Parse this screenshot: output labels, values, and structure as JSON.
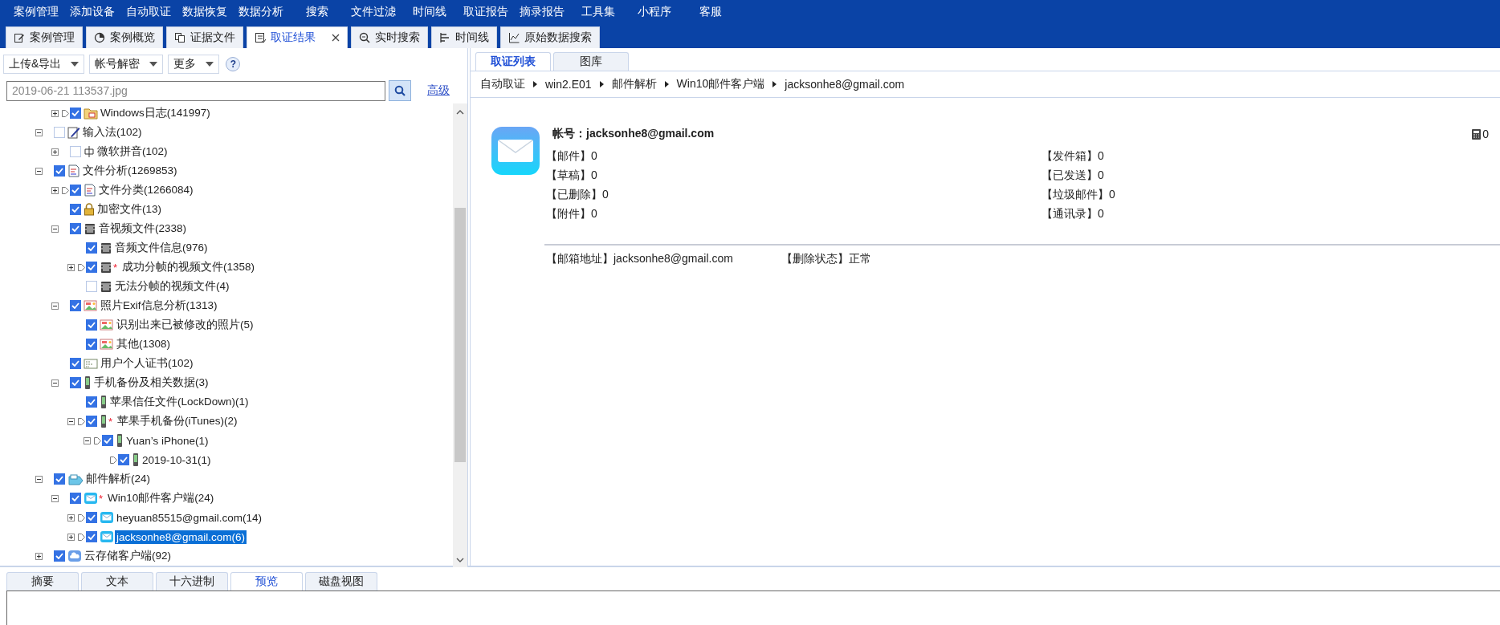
{
  "menu": [
    {
      "label": "案例管理"
    },
    {
      "label": "添加设备"
    },
    {
      "label": "自动取证"
    },
    {
      "label": "数据恢复"
    },
    {
      "label": "数据分析"
    },
    {
      "label": "搜索"
    },
    {
      "label": "文件过滤"
    },
    {
      "label": "时间线"
    },
    {
      "label": "取证报告"
    },
    {
      "label": "摘录报告"
    },
    {
      "label": "工具集"
    },
    {
      "label": "小程序"
    },
    {
      "label": "客服"
    }
  ],
  "doc_tabs": [
    {
      "label": "案例管理",
      "kind": "edit",
      "selected": false
    },
    {
      "label": "案例概览",
      "kind": "pie",
      "selected": false
    },
    {
      "label": "证据文件",
      "kind": "copy",
      "selected": false
    },
    {
      "label": "取证结果",
      "kind": "list",
      "selected": true,
      "closable": true
    },
    {
      "label": "实时搜索",
      "kind": "search",
      "selected": false
    },
    {
      "label": "时间线",
      "kind": "timeline",
      "selected": false
    },
    {
      "label": "原始数据搜索",
      "kind": "chart",
      "selected": false
    }
  ],
  "left_toolbar": {
    "dropdowns": [
      "上传&导出",
      "帐号解密",
      "更多"
    ],
    "help": "?"
  },
  "search": {
    "placeholder": "2019-06-21 113537.jpg",
    "advanced_link": "高级"
  },
  "tree": {
    "continued_children": [
      {
        "label": "Windows日志(141997)",
        "kind": "log",
        "checked": true,
        "expanded": false,
        "marker": true,
        "selected": false
      }
    ],
    "items": [
      {
        "label": "输入法(102)",
        "kind": "pen",
        "checked": false,
        "expanded": true,
        "selected": false,
        "children": [
          {
            "label": "微软拼音(102)",
            "kind": "ime",
            "checked": false,
            "expanded": false,
            "selected": false
          }
        ]
      },
      {
        "label": "文件分析(1269853)",
        "kind": "doc",
        "checked": true,
        "expanded": true,
        "selected": false,
        "children": [
          {
            "label": "文件分类(1266084)",
            "kind": "doc",
            "checked": true,
            "expanded": false,
            "marker": true,
            "selected": false
          },
          {
            "label": "加密文件(13)",
            "kind": "lock",
            "checked": true,
            "selected": false
          },
          {
            "label": "音视频文件(2338)",
            "kind": "media",
            "checked": true,
            "expanded": true,
            "selected": false,
            "children": [
              {
                "label": "音频文件信息(976)",
                "kind": "media",
                "checked": true,
                "selected": false
              },
              {
                "label": "成功分帧的视频文件(1358)",
                "kind": "media",
                "checked": true,
                "expanded": false,
                "marker": true,
                "mark": "*",
                "selected": false
              },
              {
                "label": "无法分帧的视频文件(4)",
                "kind": "media",
                "checked": false,
                "selected": false
              }
            ]
          },
          {
            "label": "照片Exif信息分析(1313)",
            "kind": "photo",
            "checked": true,
            "expanded": true,
            "selected": false,
            "children": [
              {
                "label": "识别出来已被修改的照片(5)",
                "kind": "photo",
                "checked": true,
                "selected": false
              },
              {
                "label": "其他(1308)",
                "kind": "photo",
                "checked": true,
                "selected": false
              }
            ]
          },
          {
            "label": "用户个人证书(102)",
            "kind": "cert",
            "checked": true,
            "selected": false
          },
          {
            "label": "手机备份及相关数据(3)",
            "kind": "phone",
            "checked": true,
            "expanded": true,
            "selected": false,
            "children": [
              {
                "label": "苹果信任文件(LockDown)(1)",
                "kind": "phone",
                "checked": true,
                "selected": false
              },
              {
                "label": "苹果手机备份(iTunes)(2)",
                "kind": "phone",
                "checked": true,
                "expanded": true,
                "marker": true,
                "mark": "*",
                "selected": false,
                "children": [
                  {
                    "label": "Yuan’s iPhone(1)",
                    "kind": "phone",
                    "checked": true,
                    "expanded": true,
                    "marker": true,
                    "selected": false,
                    "children": [
                      {
                        "label": "2019-10-31(1)",
                        "kind": "phone",
                        "checked": true,
                        "marker": true,
                        "selected": false
                      }
                    ]
                  }
                ]
              }
            ]
          }
        ]
      },
      {
        "label": "邮件解析(24)",
        "kind": "mailbox",
        "checked": true,
        "expanded": true,
        "selected": false,
        "children": [
          {
            "label": "Win10邮件客户端(24)",
            "kind": "mail",
            "checked": true,
            "expanded": true,
            "mark": "*",
            "selected": false,
            "children": [
              {
                "label": "heyuan85515@gmail.com(14)",
                "kind": "mail",
                "checked": true,
                "expanded": false,
                "marker": true,
                "selected": false
              },
              {
                "label": "jacksonhe8@gmail.com(6)",
                "kind": "mail",
                "checked": true,
                "expanded": false,
                "marker": true,
                "selected": true
              }
            ]
          }
        ]
      },
      {
        "label": "云存储客户端(92)",
        "kind": "cloud",
        "checked": true,
        "expanded": false,
        "selected": false
      }
    ]
  },
  "right_tabs": [
    {
      "label": "取证列表",
      "selected": true
    },
    {
      "label": "图库",
      "selected": false
    }
  ],
  "breadcrumb": [
    "自动取证",
    "win2.E01",
    "邮件解析",
    "Win10邮件客户端",
    "jacksonhe8@gmail.com"
  ],
  "account": {
    "title": "帐号：jacksonhe8@gmail.com",
    "counter": "0",
    "stats_left": [
      "【邮件】0",
      "【草稿】0",
      "【已删除】0",
      "【附件】0"
    ],
    "stats_right": [
      "【发件箱】0",
      "【已发送】0",
      "【垃圾邮件】0",
      "【通讯录】0"
    ],
    "details": [
      "【邮箱地址】jacksonhe8@gmail.com",
      "【删除状态】正常"
    ]
  },
  "bottom_tabs": [
    {
      "label": "摘要",
      "selected": false
    },
    {
      "label": "文本",
      "selected": false
    },
    {
      "label": "十六进制",
      "selected": false
    },
    {
      "label": "预览",
      "selected": true
    },
    {
      "label": "磁盘视图",
      "selected": false
    }
  ]
}
